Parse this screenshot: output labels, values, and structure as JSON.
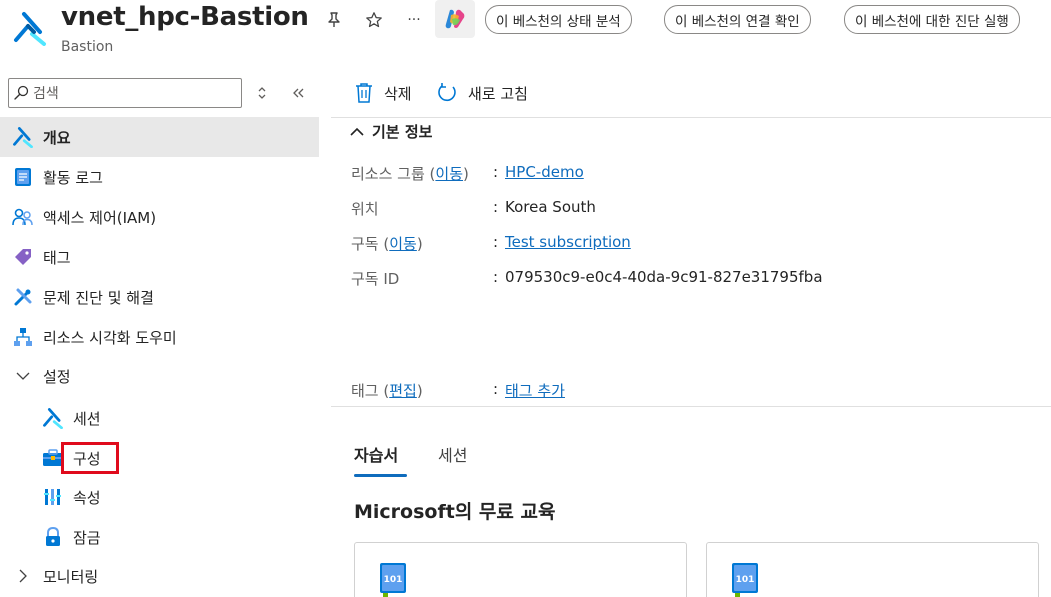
{
  "header": {
    "title": "vnet_hpc-Bastion",
    "subtitle": "Bastion",
    "pin_icon": "pin-icon",
    "star_icon": "star-icon",
    "more_label": "···",
    "copilot_icon": "copilot-icon",
    "pills": [
      "이 베스천의 상태 분석",
      "이 베스천의 연결 확인",
      "이 베스천에 대한 진단 실행"
    ]
  },
  "sidebar": {
    "search_placeholder": "검색",
    "items": [
      {
        "label": "개요",
        "icon": "bastion-icon",
        "active": true
      },
      {
        "label": "활동 로그",
        "icon": "activity-log-icon"
      },
      {
        "label": "액세스 제어(IAM)",
        "icon": "iam-icon"
      },
      {
        "label": "태그",
        "icon": "tag-icon"
      },
      {
        "label": "문제 진단 및 해결",
        "icon": "diagnose-icon"
      },
      {
        "label": "리소스 시각화 도우미",
        "icon": "visualizer-icon"
      },
      {
        "label": "설정",
        "icon": "chevron-down-icon",
        "group": true
      },
      {
        "label": "세션",
        "icon": "session-icon"
      },
      {
        "label": "구성",
        "icon": "configuration-icon",
        "highlighted": true
      },
      {
        "label": "속성",
        "icon": "properties-icon"
      },
      {
        "label": "잠금",
        "icon": "lock-icon"
      },
      {
        "label": "모니터링",
        "icon": "chevron-right-icon",
        "group": true
      }
    ]
  },
  "toolbar": {
    "delete_label": "삭제",
    "refresh_label": "새로 고침"
  },
  "essentials": {
    "heading": "기본 정보",
    "resource_group_label": "리소스 그룹",
    "move_link": "이동",
    "resource_group_value": "HPC-demo",
    "location_label": "위치",
    "location_value": "Korea South",
    "subscription_label": "구독",
    "subscription_value": "Test subscription",
    "subscription_id_label": "구독 ID",
    "subscription_id_value": "079530c9-e0c4-40da-9c91-827e31795fba",
    "tags_label": "태그",
    "edit_link": "편집",
    "add_tags_link": "태그 추가"
  },
  "tabs": [
    "자습서",
    "세션"
  ],
  "learn": {
    "title": "Microsoft의 무료 교육",
    "card_badge": "101"
  },
  "colors": {
    "accent": "#0f6cbd",
    "highlight_border": "#e00b1c"
  }
}
